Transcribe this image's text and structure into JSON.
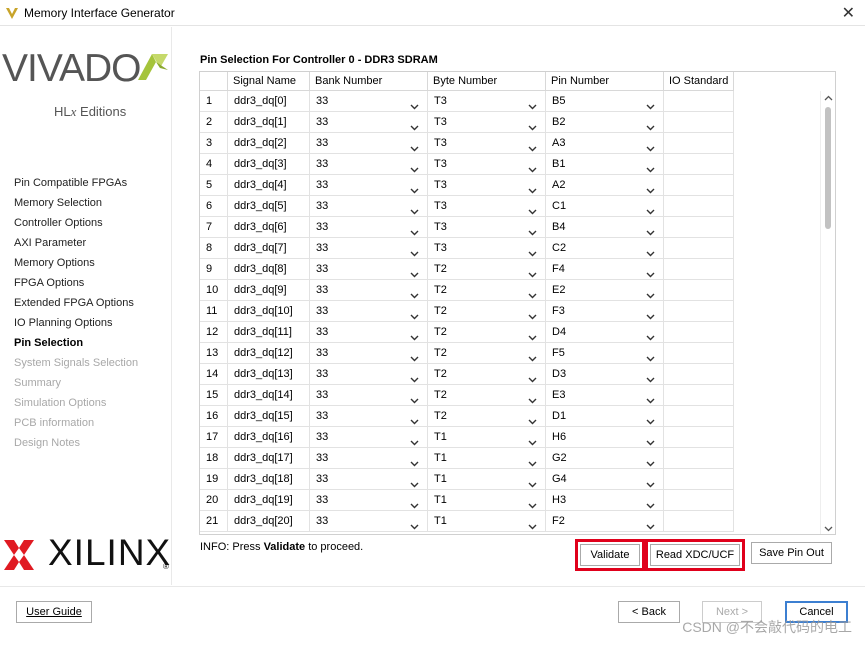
{
  "window": {
    "title": "Memory Interface Generator",
    "close_glyph": "✕"
  },
  "branding": {
    "vivado": "VIVADO",
    "hlx_prefix": "HL",
    "hlx_x": "x",
    "hlx_suffix": " Editions",
    "xilinx": "XILINX",
    "registered": "®"
  },
  "sidebar": {
    "items": [
      {
        "label": "Pin Compatible FPGAs",
        "state": "normal"
      },
      {
        "label": "Memory Selection",
        "state": "normal"
      },
      {
        "label": "Controller Options",
        "state": "normal"
      },
      {
        "label": "AXI Parameter",
        "state": "normal"
      },
      {
        "label": "Memory Options",
        "state": "normal"
      },
      {
        "label": "FPGA Options",
        "state": "normal"
      },
      {
        "label": "Extended FPGA Options",
        "state": "normal"
      },
      {
        "label": "IO Planning Options",
        "state": "normal"
      },
      {
        "label": "Pin Selection",
        "state": "active"
      },
      {
        "label": "System Signals Selection",
        "state": "disabled"
      },
      {
        "label": "Summary",
        "state": "disabled"
      },
      {
        "label": "Simulation Options",
        "state": "disabled"
      },
      {
        "label": "PCB information",
        "state": "disabled"
      },
      {
        "label": "Design Notes",
        "state": "disabled"
      }
    ]
  },
  "main": {
    "section_title": "Pin Selection For Controller 0 - DDR3 SDRAM",
    "table": {
      "columns": [
        "",
        "Signal Name",
        "Bank Number",
        "Byte Number",
        "Pin Number",
        "IO Standard"
      ],
      "rows": [
        {
          "idx": "1",
          "signal": "ddr3_dq[0]",
          "bank": "33",
          "byte": "T3",
          "pin": "B5",
          "io": ""
        },
        {
          "idx": "2",
          "signal": "ddr3_dq[1]",
          "bank": "33",
          "byte": "T3",
          "pin": "B2",
          "io": ""
        },
        {
          "idx": "3",
          "signal": "ddr3_dq[2]",
          "bank": "33",
          "byte": "T3",
          "pin": "A3",
          "io": ""
        },
        {
          "idx": "4",
          "signal": "ddr3_dq[3]",
          "bank": "33",
          "byte": "T3",
          "pin": "B1",
          "io": ""
        },
        {
          "idx": "5",
          "signal": "ddr3_dq[4]",
          "bank": "33",
          "byte": "T3",
          "pin": "A2",
          "io": ""
        },
        {
          "idx": "6",
          "signal": "ddr3_dq[5]",
          "bank": "33",
          "byte": "T3",
          "pin": "C1",
          "io": ""
        },
        {
          "idx": "7",
          "signal": "ddr3_dq[6]",
          "bank": "33",
          "byte": "T3",
          "pin": "B4",
          "io": ""
        },
        {
          "idx": "8",
          "signal": "ddr3_dq[7]",
          "bank": "33",
          "byte": "T3",
          "pin": "C2",
          "io": ""
        },
        {
          "idx": "9",
          "signal": "ddr3_dq[8]",
          "bank": "33",
          "byte": "T2",
          "pin": "F4",
          "io": ""
        },
        {
          "idx": "10",
          "signal": "ddr3_dq[9]",
          "bank": "33",
          "byte": "T2",
          "pin": "E2",
          "io": ""
        },
        {
          "idx": "11",
          "signal": "ddr3_dq[10]",
          "bank": "33",
          "byte": "T2",
          "pin": "F3",
          "io": ""
        },
        {
          "idx": "12",
          "signal": "ddr3_dq[11]",
          "bank": "33",
          "byte": "T2",
          "pin": "D4",
          "io": ""
        },
        {
          "idx": "13",
          "signal": "ddr3_dq[12]",
          "bank": "33",
          "byte": "T2",
          "pin": "F5",
          "io": ""
        },
        {
          "idx": "14",
          "signal": "ddr3_dq[13]",
          "bank": "33",
          "byte": "T2",
          "pin": "D3",
          "io": ""
        },
        {
          "idx": "15",
          "signal": "ddr3_dq[14]",
          "bank": "33",
          "byte": "T2",
          "pin": "E3",
          "io": ""
        },
        {
          "idx": "16",
          "signal": "ddr3_dq[15]",
          "bank": "33",
          "byte": "T2",
          "pin": "D1",
          "io": ""
        },
        {
          "idx": "17",
          "signal": "ddr3_dq[16]",
          "bank": "33",
          "byte": "T1",
          "pin": "H6",
          "io": ""
        },
        {
          "idx": "18",
          "signal": "ddr3_dq[17]",
          "bank": "33",
          "byte": "T1",
          "pin": "G2",
          "io": ""
        },
        {
          "idx": "19",
          "signal": "ddr3_dq[18]",
          "bank": "33",
          "byte": "T1",
          "pin": "G4",
          "io": ""
        },
        {
          "idx": "20",
          "signal": "ddr3_dq[19]",
          "bank": "33",
          "byte": "T1",
          "pin": "H3",
          "io": ""
        },
        {
          "idx": "21",
          "signal": "ddr3_dq[20]",
          "bank": "33",
          "byte": "T1",
          "pin": "F2",
          "io": ""
        }
      ]
    },
    "info_prefix": "INFO: Press ",
    "info_bold": "Validate",
    "info_suffix": " to proceed.",
    "buttons": {
      "validate": "Validate",
      "read_xdc": "Read XDC/UCF",
      "save_pin_out": "Save Pin Out"
    }
  },
  "footer": {
    "user_guide": "User Guide",
    "back": "< Back",
    "next": "Next >",
    "cancel": "Cancel"
  },
  "watermark": "CSDN @不会敲代码的电工",
  "colors": {
    "highlight_red": "#e0001b",
    "primary_blue": "#3c7fd1",
    "vivado_green": "#a5c43b",
    "xilinx_red": "#e01a22"
  }
}
